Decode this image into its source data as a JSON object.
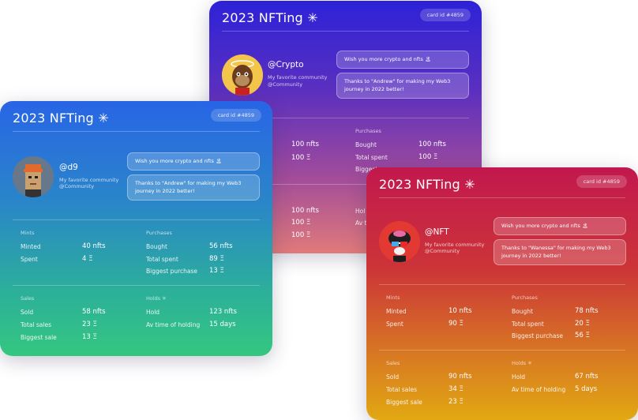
{
  "cards": {
    "purple": {
      "title": "2023 NFTing ✳",
      "card_id": "card id #4859",
      "handle": "@Crypto",
      "subtitle_line1": "My favorite community",
      "subtitle_line2": "@Community",
      "message1": "Wish you more crypto and nfts 🏝",
      "message2": "Thanks to \"Andrew\" for making my Web3 journey in 2022 better!",
      "purchases_label": "Purchases",
      "bought_label": "Bought",
      "bought_value": "100 nfts",
      "total_spent_label": "Total spent",
      "total_spent_value": "100 Ξ",
      "biggest_label": "Biggest",
      "visible_left_values": [
        "100 nfts",
        "100 Ξ",
        "100 nfts",
        "100 Ξ",
        "100 Ξ"
      ],
      "holds_partial": "Hol",
      "av_partial": "Av t"
    },
    "blue": {
      "title": "2023 NFTing ✳",
      "card_id": "card id #4859",
      "handle": "@d9",
      "subtitle_line1": "My favorite community",
      "subtitle_line2": "@Community",
      "message1": "Wish you more crypto and nfts 🏝",
      "message2": "Thanks to \"Andrew\" for making my Web3 journey in 2022 better!",
      "mints_label": "Mints",
      "minted_label": "Minted",
      "minted_value": "40 nfts",
      "spent_label": "Spent",
      "spent_value": "4 Ξ",
      "purchases_label": "Purchases",
      "bought_label": "Bought",
      "bought_value": "56 nfts",
      "total_spent_label": "Total spent",
      "total_spent_value": "89 Ξ",
      "biggest_purchase_label": "Biggest purchase",
      "biggest_purchase_value": "13 Ξ",
      "sales_label": "Sales",
      "sold_label": "Sold",
      "sold_value": "58 nfts",
      "total_sales_label": "Total sales",
      "total_sales_value": "23 Ξ",
      "biggest_sale_label": "Biggest sale",
      "biggest_sale_value": "13 Ξ",
      "holds_label": "Holds ✳",
      "hold_label": "Hold",
      "hold_value": "123 nfts",
      "av_time_label": "Av time of holding",
      "av_time_value": "15 days"
    },
    "red": {
      "title": "2023 NFTing ✳",
      "card_id": "card id #4859",
      "handle": "@NFT",
      "subtitle_line1": "My favorite community",
      "subtitle_line2": "@Community",
      "message1": "Wish you more crypto and nfts 🏝",
      "message2": "Thanks to \"Wanessa\" for making my Web3 journey in 2022 better!",
      "mints_label": "Mints",
      "minted_label": "Minted",
      "minted_value": "10 nfts",
      "spent_label": "Spent",
      "spent_value": "90 Ξ",
      "purchases_label": "Purchases",
      "bought_label": "Bought",
      "bought_value": "78 nfts",
      "total_spent_label": "Total spent",
      "total_spent_value": "20 Ξ",
      "biggest_purchase_label": "Biggest purchase",
      "biggest_purchase_value": "56 Ξ",
      "sales_label": "Sales",
      "sold_label": "Sold",
      "sold_value": "90 nfts",
      "total_sales_label": "Total sales",
      "total_sales_value": "34 Ξ",
      "biggest_sale_label": "Biggest sale",
      "biggest_sale_value": "23 Ξ",
      "holds_label": "Holds ✳",
      "hold_label": "Hold",
      "hold_value": "67 nfts",
      "av_time_label": "Av time of holding",
      "av_time_value": "5 days"
    }
  }
}
